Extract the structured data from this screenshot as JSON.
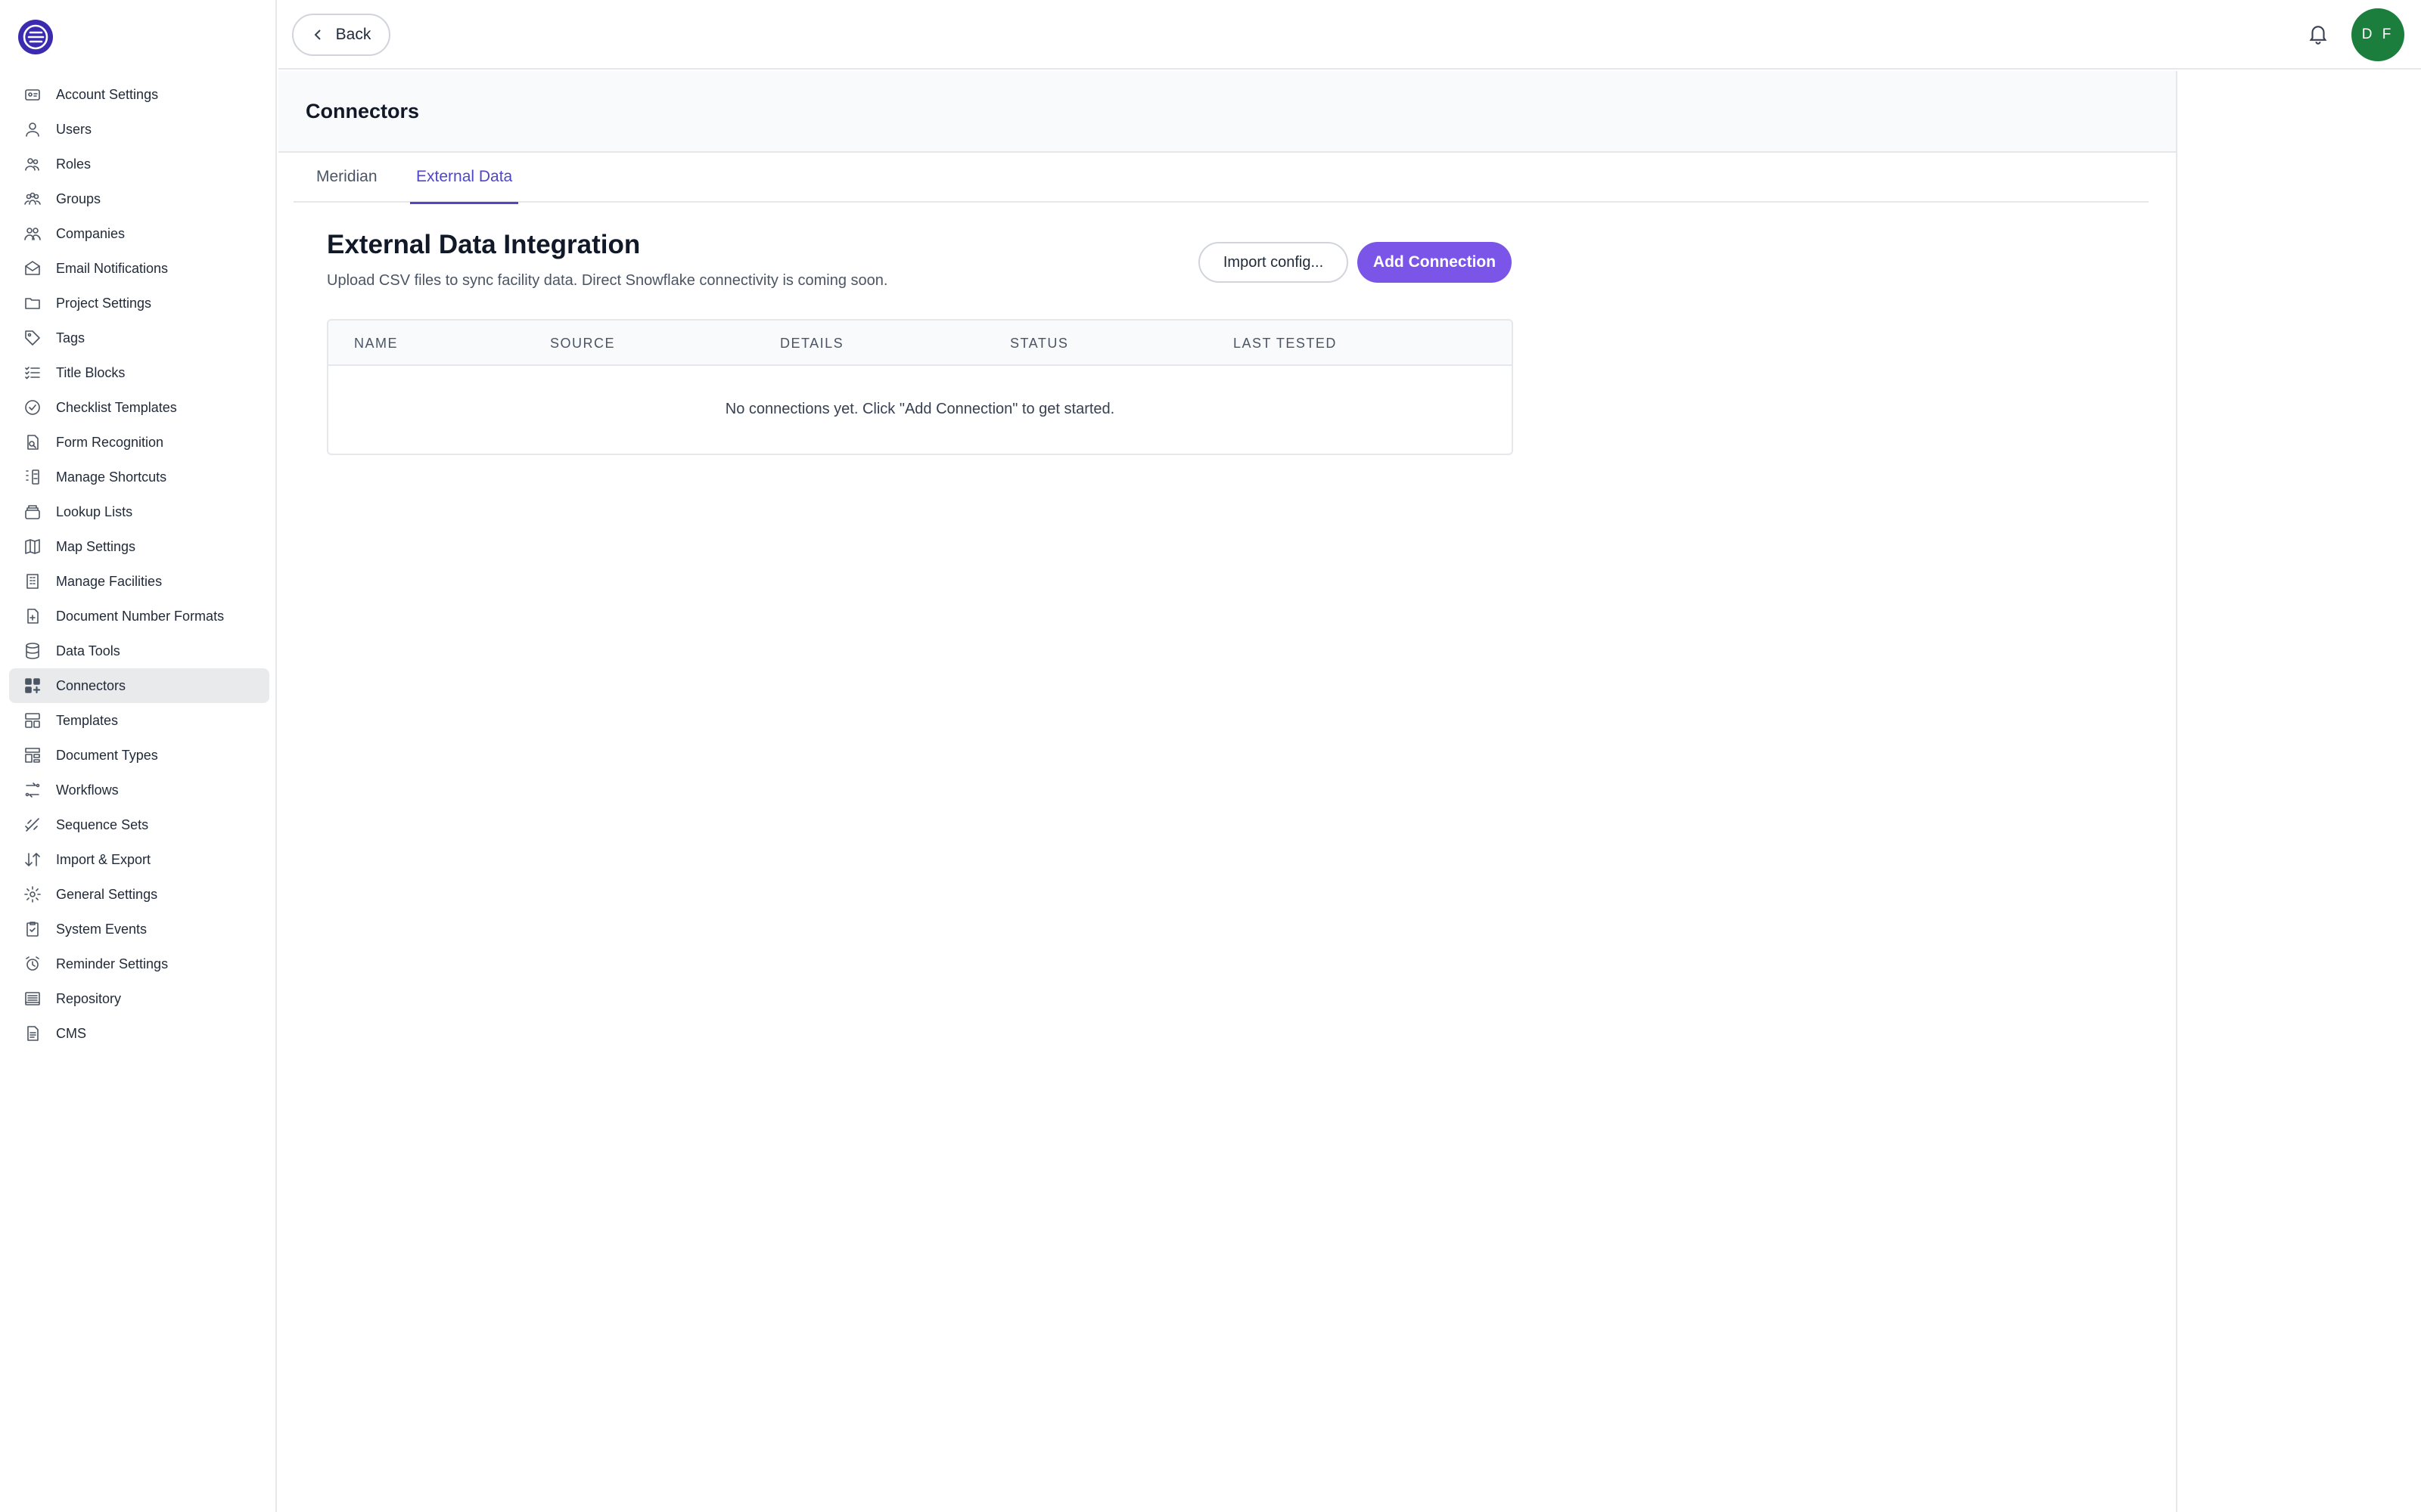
{
  "sidebar": {
    "items": [
      {
        "label": "Account Settings",
        "icon": "account-card-icon"
      },
      {
        "label": "Users",
        "icon": "user-icon"
      },
      {
        "label": "Roles",
        "icon": "roles-icon"
      },
      {
        "label": "Groups",
        "icon": "group-icon"
      },
      {
        "label": "Companies",
        "icon": "companies-icon"
      },
      {
        "label": "Email Notifications",
        "icon": "mail-icon"
      },
      {
        "label": "Project Settings",
        "icon": "folder-icon"
      },
      {
        "label": "Tags",
        "icon": "tag-icon"
      },
      {
        "label": "Title Blocks",
        "icon": "list-check-icon"
      },
      {
        "label": "Checklist Templates",
        "icon": "check-circle-icon"
      },
      {
        "label": "Form Recognition",
        "icon": "form-scan-icon"
      },
      {
        "label": "Manage Shortcuts",
        "icon": "shortcut-icon"
      },
      {
        "label": "Lookup Lists",
        "icon": "stack-icon"
      },
      {
        "label": "Map Settings",
        "icon": "map-icon"
      },
      {
        "label": "Manage Facilities",
        "icon": "building-icon"
      },
      {
        "label": "Document Number Formats",
        "icon": "doc-plus-icon"
      },
      {
        "label": "Data Tools",
        "icon": "database-icon"
      },
      {
        "label": "Connectors",
        "icon": "grid-plus-icon"
      },
      {
        "label": "Templates",
        "icon": "template-icon"
      },
      {
        "label": "Document Types",
        "icon": "doc-types-icon"
      },
      {
        "label": "Workflows",
        "icon": "workflow-icon"
      },
      {
        "label": "Sequence Sets",
        "icon": "sequence-icon"
      },
      {
        "label": "Import & Export",
        "icon": "arrows-icon"
      },
      {
        "label": "General Settings",
        "icon": "gear-icon"
      },
      {
        "label": "System Events",
        "icon": "clipboard-check-icon"
      },
      {
        "label": "Reminder Settings",
        "icon": "alarm-icon"
      },
      {
        "label": "Repository",
        "icon": "repository-icon"
      },
      {
        "label": "CMS",
        "icon": "file-text-icon"
      }
    ],
    "active": "Connectors"
  },
  "topbar": {
    "back_label": "Back",
    "avatar_initials": "D F"
  },
  "page": {
    "title": "Connectors",
    "tabs": [
      {
        "label": "Meridian",
        "active": false
      },
      {
        "label": "External Data",
        "active": true
      }
    ]
  },
  "section": {
    "title": "External Data Integration",
    "subtitle": "Upload CSV files to sync facility data. Direct Snowflake connectivity is coming soon.",
    "import_label": "Import config...",
    "add_label": "Add Connection"
  },
  "table": {
    "columns": [
      "NAME",
      "SOURCE",
      "DETAILS",
      "STATUS",
      "LAST TESTED"
    ],
    "empty_message": "No connections yet. Click \"Add Connection\" to get started."
  },
  "colors": {
    "accent": "#7b55e8",
    "tab_active": "#4f46c8",
    "avatar": "#1b7e3c",
    "logo": "#3b2bb0"
  }
}
